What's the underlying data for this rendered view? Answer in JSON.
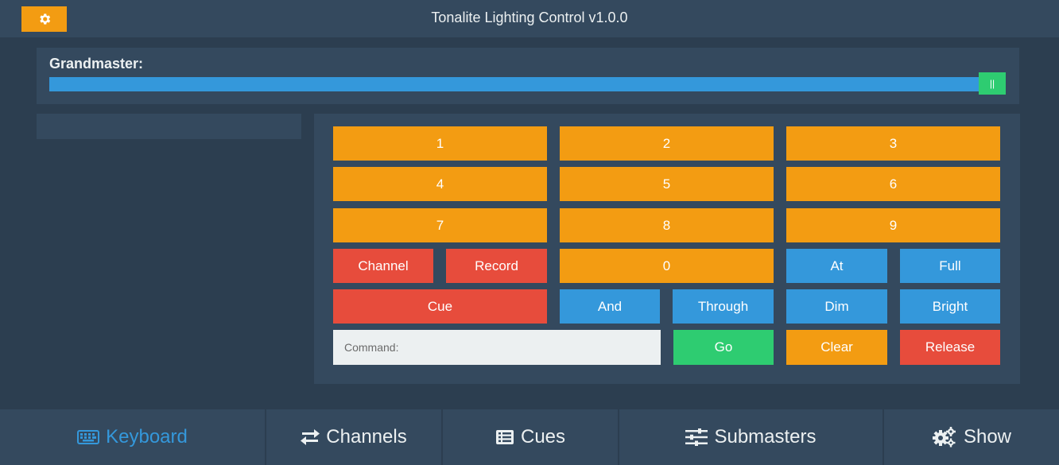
{
  "header": {
    "title": "Tonalite Lighting Control v1.0.0",
    "settings_icon": "gear-icon"
  },
  "grandmaster": {
    "label": "Grandmaster:",
    "value": 1.0,
    "thumb_glyph": "||"
  },
  "keypad": {
    "digits": [
      "1",
      "2",
      "3",
      "4",
      "5",
      "6",
      "7",
      "8",
      "9",
      "0"
    ],
    "channel": "Channel",
    "record": "Record",
    "cue": "Cue",
    "and": "And",
    "through": "Through",
    "at": "At",
    "full": "Full",
    "dim": "Dim",
    "bright": "Bright",
    "go": "Go",
    "clear": "Clear",
    "release": "Release",
    "command_placeholder": "Command:"
  },
  "colors": {
    "orange": "#f39c12",
    "red": "#e74c3c",
    "blue": "#3498db",
    "green": "#2ecc71",
    "panel": "#34495e",
    "background": "#2c3e50"
  },
  "nav": {
    "items": [
      {
        "label": "Keyboard",
        "icon": "keyboard-icon",
        "active": true
      },
      {
        "label": "Channels",
        "icon": "exchange-icon",
        "active": false
      },
      {
        "label": "Cues",
        "icon": "list-icon",
        "active": false
      },
      {
        "label": "Submasters",
        "icon": "sliders-icon",
        "active": false
      },
      {
        "label": "Show",
        "icon": "cogs-icon",
        "active": false
      }
    ]
  }
}
